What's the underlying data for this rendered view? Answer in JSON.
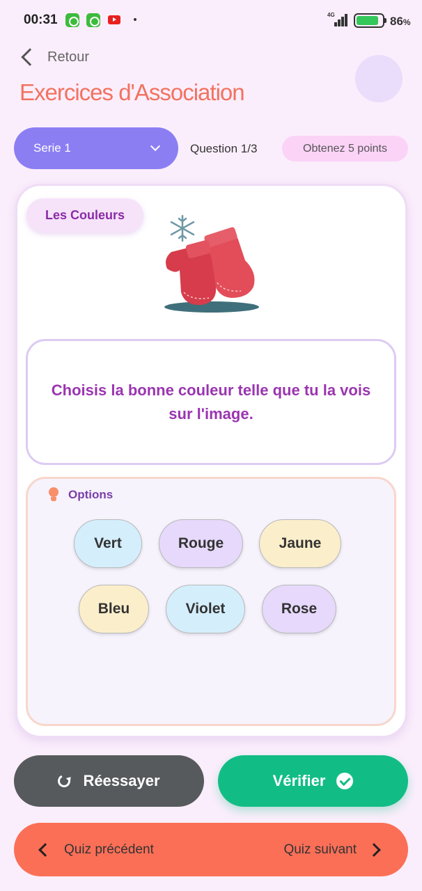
{
  "status_bar": {
    "time": "00:31",
    "network_label": "4G",
    "battery_percent": "86",
    "battery_unit": "%",
    "battery_level": 0.86
  },
  "header": {
    "back_label": "Retour",
    "title": "Exercices d'Association"
  },
  "controls": {
    "serie_selected": "Serie 1",
    "question_counter": "Question 1/3",
    "points_badge": "Obtenez 5 points"
  },
  "card": {
    "topic": "Les Couleurs",
    "image_icon": "mittens-snowflake-image",
    "prompt": "Choisis la bonne couleur telle que tu la vois sur l'image.",
    "options_label": "Options",
    "options": [
      "Vert",
      "Rouge",
      "Jaune",
      "Bleu",
      "Violet",
      "Rose"
    ]
  },
  "actions": {
    "retry_label": "Réessayer",
    "verify_label": "Vérifier"
  },
  "navigation": {
    "prev_label": "Quiz précédent",
    "next_label": "Quiz suivant"
  },
  "colors": {
    "background": "#fbeefc",
    "title": "#f27260",
    "serie_select": "#8b7ef3",
    "verify": "#12bd85",
    "retry": "#565a5c",
    "nav_bar": "#fb6f57",
    "prompt_text": "#9a35b0"
  }
}
